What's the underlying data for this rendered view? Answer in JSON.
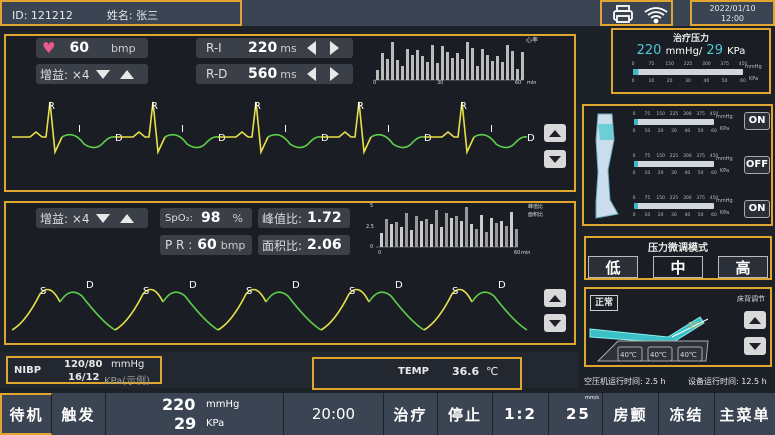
{
  "header": {
    "id_text": "ID: 121212",
    "name_text": "姓名: 张三",
    "date": "2022/01/10",
    "time": "12:00"
  },
  "ecg": {
    "hr_value": "60",
    "hr_unit": "bmp",
    "gain_label": "增益: ×4",
    "ri_label": "R-I",
    "ri_value": "220",
    "ri_unit": "ms",
    "rd_label": "R-D",
    "rd_value": "560",
    "rd_unit": "ms",
    "hist_legend": "心率",
    "hist_x": [
      "0",
      "30",
      "60"
    ],
    "hist_unit": "min",
    "wave_labels": [
      "R",
      "I",
      "D"
    ]
  },
  "pleth": {
    "gain_label": "增益: ×4",
    "spo2_label": "SpO₂:",
    "spo2_value": "98",
    "spo2_unit": "%",
    "pr_label": "P R :",
    "pr_value": "60",
    "pr_unit": "bmp",
    "peak_label": "峰值比:",
    "peak_value": "1.72",
    "area_label": "面积比:",
    "area_value": "2.06",
    "hist_legend1": "峰值比",
    "hist_legend2": "面积比",
    "hist_y": [
      "5",
      "2.5",
      "0"
    ],
    "hist_x": [
      "0",
      "60"
    ],
    "hist_unit": "min",
    "wave_labels": [
      "S",
      "D"
    ]
  },
  "pressure": {
    "title": "治疗压力",
    "mmhg_value": "220",
    "mmhg_unit": "mmHg/",
    "kpa_value": "29",
    "kpa_unit": "KPa",
    "scale_mmhg": [
      "0",
      "75",
      "150",
      "225",
      "300",
      "375",
      "450"
    ],
    "scale_kpa": [
      "0",
      "10",
      "20",
      "30",
      "40",
      "50",
      "60"
    ],
    "unit_mmhg": "mmHg",
    "unit_kpa": "KPa"
  },
  "cuffs": {
    "states": [
      "ON",
      "OFF",
      "ON"
    ]
  },
  "fine_mode": {
    "title": "压力微调模式",
    "options": [
      "低",
      "中",
      "高"
    ],
    "selected": 1
  },
  "bed": {
    "mode": "正常",
    "label": "床背调节",
    "angle": "30°",
    "temps": [
      "40℃",
      "40℃",
      "40℃"
    ]
  },
  "runtime": {
    "compressor": "空压机运行时间: 2.5 h",
    "device": "设备运行时间: 12.5 h"
  },
  "nibp": {
    "label": "NIBP",
    "mmhg": "120/80",
    "mmhg_unit": "mmHg",
    "kpa": "16/12",
    "kpa_unit": "KPa(示例)"
  },
  "temp": {
    "label": "TEMP",
    "value": "36.6",
    "unit": "℃"
  },
  "bottom": {
    "standby": "待机",
    "trigger": "触发",
    "pressure_mmhg": "220",
    "pressure_mmhg_unit": "mmHg",
    "pressure_kpa": "29",
    "pressure_kpa_unit": "KPa",
    "timer": "20:00",
    "treat": "治疗",
    "stop": "停止",
    "ratio": "1:2",
    "speed": "25",
    "speed_unit": "mm/s",
    "atrial": "房颤",
    "freeze": "冻结",
    "menu": "主菜单"
  }
}
